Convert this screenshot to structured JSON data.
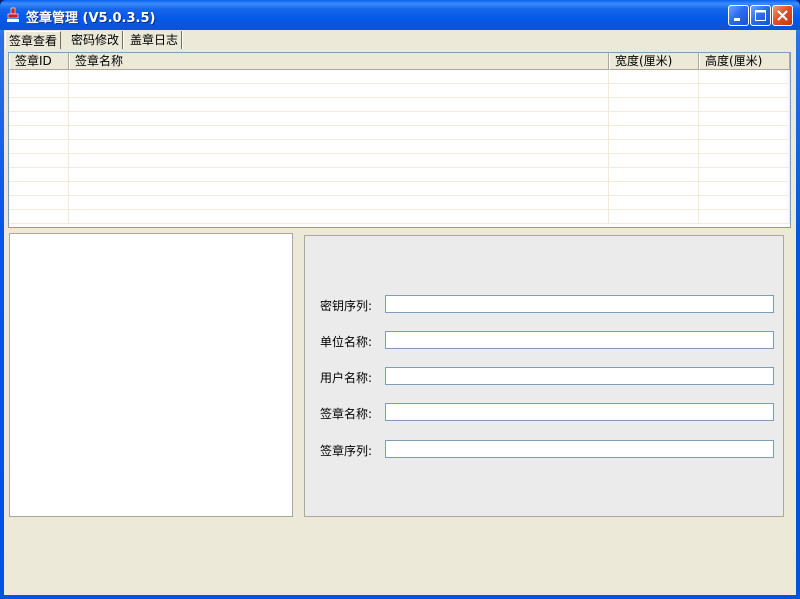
{
  "window": {
    "title": "签章管理 (V5.0.3.5)"
  },
  "tabs": [
    {
      "label": "签章查看"
    },
    {
      "label": "密码修改"
    },
    {
      "label": "盖章日志"
    }
  ],
  "table": {
    "columns": [
      "签章ID",
      "签章名称",
      "宽度(厘米)",
      "高度(厘米)"
    ],
    "rows": []
  },
  "form": {
    "fields": [
      {
        "label": "密钥序列:",
        "value": ""
      },
      {
        "label": "单位名称:",
        "value": ""
      },
      {
        "label": "用户名称:",
        "value": ""
      },
      {
        "label": "签章名称:",
        "value": ""
      },
      {
        "label": "签章序列:",
        "value": ""
      }
    ]
  },
  "colors": {
    "titlebar": "#0a5ff2",
    "client": "#ece9d8",
    "close_button": "#e0502a"
  },
  "icons": {
    "app": "seal-stamp-icon",
    "minimize": "minimize-icon",
    "maximize": "maximize-icon",
    "close": "close-icon"
  }
}
